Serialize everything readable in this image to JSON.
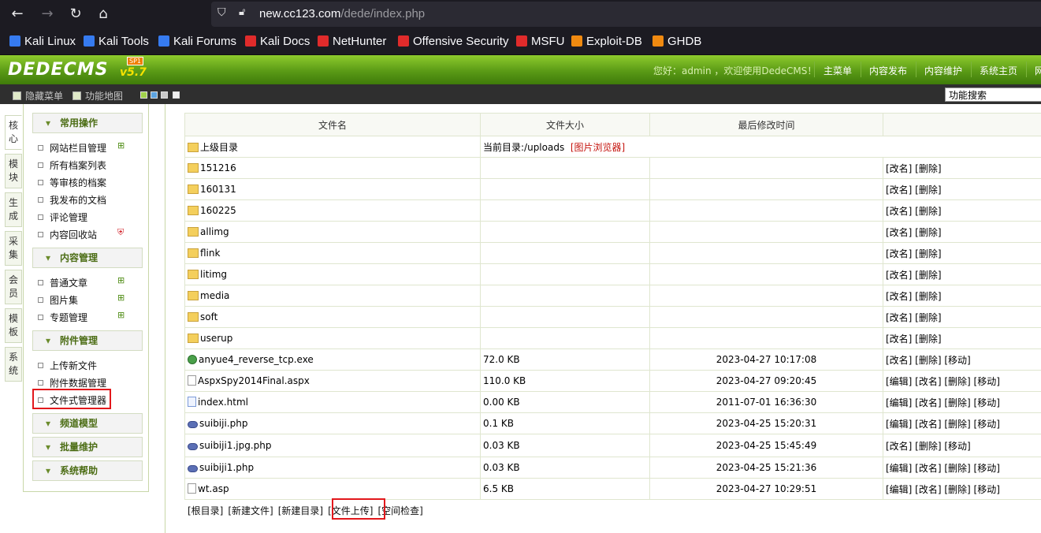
{
  "browser": {
    "url_host": "new.cc123.com",
    "url_path": "/dede/index.php"
  },
  "bookmarks": [
    {
      "label": "Kali Linux",
      "color": "#367bf0"
    },
    {
      "label": "Kali Tools",
      "color": "#367bf0"
    },
    {
      "label": "Kali Forums",
      "color": "#367bf0"
    },
    {
      "label": "Kali Docs",
      "color": "#e02b2b"
    },
    {
      "label": "NetHunter",
      "color": "#e02b2b"
    },
    {
      "label": "Offensive Security",
      "color": "#e02b2b"
    },
    {
      "label": "MSFU",
      "color": "#e02b2b"
    },
    {
      "label": "Exploit-DB",
      "color": "#f08a10"
    },
    {
      "label": "GHDB",
      "color": "#f08a10"
    }
  ],
  "header": {
    "logo": "DEDECMS",
    "version": "v5.7",
    "sp": "SP1",
    "welcome": "您好：admin ，欢迎使用DedeCMS！",
    "nav": [
      "主菜单",
      "内容发布",
      "内容维护",
      "系统主页",
      "网"
    ]
  },
  "toolbar": {
    "hide_menu": "隐藏菜单",
    "func_map": "功能地图",
    "search_placeholder": "功能搜索"
  },
  "vtabs": [
    "核心",
    "模块",
    "生成",
    "采集",
    "会员",
    "模板",
    "系统"
  ],
  "menu": {
    "groups": [
      {
        "title": "常用操作",
        "items": [
          "网站栏目管理",
          "所有档案列表",
          "等审核的档案",
          "我发布的文档",
          "评论管理",
          "内容回收站"
        ]
      },
      {
        "title": "内容管理",
        "items": [
          "普通文章",
          "图片集",
          "专题管理"
        ]
      },
      {
        "title": "附件管理",
        "items": [
          "上传新文件",
          "附件数据管理",
          "文件式管理器"
        ]
      },
      {
        "title": "频道模型",
        "items": []
      },
      {
        "title": "批量维护",
        "items": []
      },
      {
        "title": "系统帮助",
        "items": []
      }
    ]
  },
  "filetable": {
    "headers": [
      "文件名",
      "文件大小",
      "最后修改时间",
      ""
    ],
    "parent_label": "上级目录",
    "current_dir": "当前目录:/uploads",
    "image_browser": "[图片浏览器]",
    "rows": [
      {
        "name": "151216",
        "size": "",
        "time": "",
        "actions": "[改名] [删除]",
        "icon": "folder"
      },
      {
        "name": "160131",
        "size": "",
        "time": "",
        "actions": "[改名] [删除]",
        "icon": "folder"
      },
      {
        "name": "160225",
        "size": "",
        "time": "",
        "actions": "[改名] [删除]",
        "icon": "folder"
      },
      {
        "name": "allimg",
        "size": "",
        "time": "",
        "actions": "[改名] [删除]",
        "icon": "folder"
      },
      {
        "name": "flink",
        "size": "",
        "time": "",
        "actions": "[改名] [删除]",
        "icon": "folder"
      },
      {
        "name": "litimg",
        "size": "",
        "time": "",
        "actions": "[改名] [删除]",
        "icon": "folder"
      },
      {
        "name": "media",
        "size": "",
        "time": "",
        "actions": "[改名] [删除]",
        "icon": "folder"
      },
      {
        "name": "soft",
        "size": "",
        "time": "",
        "actions": "[改名] [删除]",
        "icon": "folder"
      },
      {
        "name": "userup",
        "size": "",
        "time": "",
        "actions": "[改名] [删除]",
        "icon": "folder"
      },
      {
        "name": "anyue4_reverse_tcp.exe",
        "size": "72.0 KB",
        "time": "2023-04-27 10:17:08",
        "actions": "[改名] [删除] [移动]",
        "icon": "exe"
      },
      {
        "name": "AspxSpy2014Final.aspx",
        "size": "110.0 KB",
        "time": "2023-04-27 09:20:45",
        "actions": "[编辑] [改名] [删除] [移动]",
        "icon": "file"
      },
      {
        "name": "index.html",
        "size": "0.00 KB",
        "time": "2011-07-01 16:36:30",
        "actions": "[编辑] [改名] [删除] [移动]",
        "icon": "html"
      },
      {
        "name": "suibiji.php",
        "size": "0.1 KB",
        "time": "2023-04-25 15:20:31",
        "actions": "[编辑] [改名] [删除] [移动]",
        "icon": "php"
      },
      {
        "name": "suibiji1.jpg.php",
        "size": "0.03 KB",
        "time": "2023-04-25 15:45:49",
        "actions": "[改名] [删除] [移动]",
        "icon": "php"
      },
      {
        "name": "suibiji1.php",
        "size": "0.03 KB",
        "time": "2023-04-25 15:21:36",
        "actions": "[编辑] [改名] [删除] [移动]",
        "icon": "php"
      },
      {
        "name": "wt.asp",
        "size": "6.5 KB",
        "time": "2023-04-27 10:29:51",
        "actions": "[编辑] [改名] [删除] [移动]",
        "icon": "file"
      }
    ]
  },
  "bottom_actions": [
    "[根目录]",
    "[新建文件]",
    "[新建目录]",
    "[文件上传]",
    "[空间检查]"
  ]
}
